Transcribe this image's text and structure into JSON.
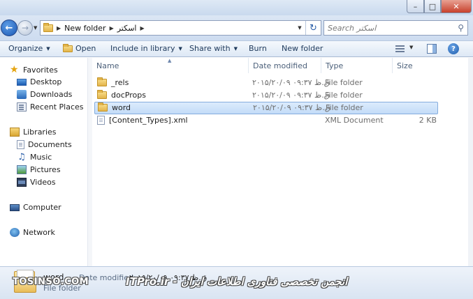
{
  "address_bar": {
    "crumbs": [
      "New folder",
      "اسکتر"
    ]
  },
  "search": {
    "placeholder": "Search اسکتر"
  },
  "command_bar": {
    "organize": "Organize",
    "open": "Open",
    "include_in_library": "Include in library",
    "share_with": "Share with",
    "burn": "Burn",
    "new_folder": "New folder"
  },
  "sidebar": {
    "favorites": "Favorites",
    "favorites_items": [
      "Desktop",
      "Downloads",
      "Recent Places"
    ],
    "libraries": "Libraries",
    "libraries_items": [
      "Documents",
      "Music",
      "Pictures",
      "Videos"
    ],
    "computer": "Computer",
    "network": "Network"
  },
  "columns": {
    "name": "Name",
    "date_modified": "Date modified",
    "type": "Type",
    "size": "Size"
  },
  "files": [
    {
      "name": "_rels",
      "date": "۲۰۱۵/۲۰/۰۹ ۰۹:۳۷ ق.ظ",
      "type": "File folder",
      "size": "",
      "icon": "folder-icon"
    },
    {
      "name": "docProps",
      "date": "۲۰۱۵/۲۰/۰۹ ۰۹:۳۷ ق.ظ",
      "type": "File folder",
      "size": "",
      "icon": "folder-icon"
    },
    {
      "name": "word",
      "date": "۲۰۱۵/۲۰/۰۹ ۰۹:۳۷ ق.ظ",
      "type": "File folder",
      "size": "",
      "icon": "folder-icon",
      "selected": true
    },
    {
      "name": "[Content_Types].xml",
      "date": "",
      "type": "XML Document",
      "size": "2 KB",
      "icon": "xml-file-icon"
    }
  ],
  "details": {
    "name": "word",
    "type": "File folder",
    "date_label": "Date modified:",
    "date_value": "۲۰۱۵/۲۰/۰۹ ق.ظ ۰۹:۳۷"
  },
  "watermarks": {
    "left": "TOSINSO.COM",
    "center": "ITPro.ir - انجمن تخصصی فناوری اطلاعات ایران"
  },
  "colors": {
    "selection_fill": "#c3dcf8",
    "selection_border": "#84acdd",
    "header_text": "#4c607a",
    "folder": "#e2b44a"
  }
}
